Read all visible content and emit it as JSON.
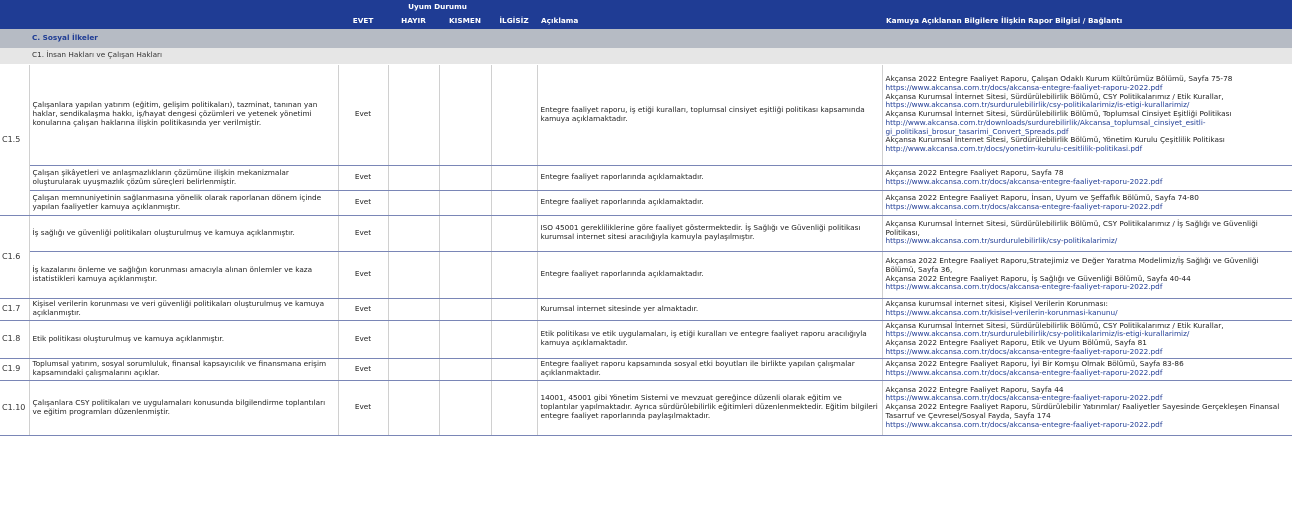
{
  "header": {
    "group_title": "Uyum Durumu",
    "col_evet": "EVET",
    "col_hayir": "HAYIR",
    "col_kismen": "KISMEN",
    "col_ilgisiz": "İLGİSİZ",
    "col_aciklama": "Açıklama",
    "col_rapor": "Kamuya Açıklanan Bilgilere İlişkin Rapor Bilgisi / Bağlantı"
  },
  "section": {
    "title": "C. Sosyal İlkeler"
  },
  "subsection": {
    "title": "C1. İnsan Hakları ve Çalışan Hakları"
  },
  "rows": [
    {
      "code": "C1.5",
      "criterion": "Çalışanlara yapılan yatırım (eğitim, gelişim politikaları), tazminat, tanınan yan haklar, sendikalaşma hakkı, iş/hayat dengesi çözümleri ve yetenek yönetimi konularına çalışan haklarına ilişkin politikasında yer verilmiştir.",
      "status": "Evet",
      "description": "Entegre faaliyet raporu, iş etiği kuralları, toplumsal cinsiyet eşitliği politikası kapsamında kamuya açıklamaktadır.",
      "report": [
        {
          "text": "Akçansa 2022 Entegre Faaliyet Raporu, Çalışan Odaklı Kurum Kültürümüz Bölümü, Sayfa 75-78",
          "link": false
        },
        {
          "text": "https://www.akcansa.com.tr/docs/akcansa-entegre-faaliyet-raporu-2022.pdf",
          "link": true
        },
        {
          "text": "Akçansa Kurumsal İnternet Sitesi, Sürdürülebilirlik Bölümü, CSY Politikalarımız / Etik Kurallar,",
          "link": false
        },
        {
          "text": "https://www.akcansa.com.tr/surdurulebilirlik/csy-politikalarimiz/is-etigi-kurallarimiz/",
          "link": true
        },
        {
          "text": "Akçansa Kurumsal İnternet Sitesi, Sürdürülebilirlik Bölümü, Toplumsal Cinsiyet Eşitliği Politikası",
          "link": false
        },
        {
          "text": "http://www.akcansa.com.tr/downloads/surdurebilirlik/Akcansa_toplumsal_cinsiyet_esitli-gi_politikasi_brosur_tasarimi_Convert_Spreads.pdf",
          "link": true
        },
        {
          "text": "Akçansa Kurumsal İnternet Sitesi, Sürdürülebilirlik Bölümü, Yönetim Kurulu Çeşitlilik Politikası",
          "link": false
        },
        {
          "text": "http://www.akcansa.com.tr/docs/yonetim-kurulu-cesitlilik-politikasi.pdf",
          "link": true
        }
      ]
    },
    {
      "code": "",
      "criterion": "Çalışan şikâyetleri ve anlaşmazlıkların çözümüne ilişkin mekanizmalar oluşturularak uyuşmazlık çözüm süreçleri belirlenmiştir.",
      "status": "Evet",
      "description": "Entegre faaliyet raporlarında açıklamaktadır.",
      "report": [
        {
          "text": "Akçansa 2022 Entegre Faaliyet Raporu, Sayfa 78",
          "link": false
        },
        {
          "text": "https://www.akcansa.com.tr/docs/akcansa-entegre-faaliyet-raporu-2022.pdf",
          "link": true
        }
      ]
    },
    {
      "code": "",
      "criterion": "Çalışan memnuniyetinin sağlanmasına yönelik olarak raporlanan dönem içinde yapılan faaliyetler kamuya açıklanmıştır.",
      "status": "Evet",
      "description": "Entegre faaliyet raporlarında açıklamaktadır.",
      "report": [
        {
          "text": "Akçansa 2022 Entegre Faaliyet Raporu, İnsan, Uyum ve Şeffaflık Bölümü, Sayfa 74-80",
          "link": false
        },
        {
          "text": "https://www.akcansa.com.tr/docs/akcansa-entegre-faaliyet-raporu-2022.pdf",
          "link": true
        }
      ]
    },
    {
      "code": "C1.6",
      "criterion": "İş sağlığı ve güvenliği politikaları oluşturulmuş ve kamuya açıklanmıştır.",
      "status": "Evet",
      "description": "ISO 45001 gerekliliklerine göre faaliyet göstermektedir. İş Sağlığı ve Güvenliği politikası kurumsal internet sitesi aracılığıyla kamuyla paylaşılmıştır.",
      "report": [
        {
          "text": "Akçansa Kurumsal İnternet Sitesi, Sürdürülebilirlik Bölümü, CSY Politikalarımız / İş Sağlığı ve Güvenliği Politikası,",
          "link": false
        },
        {
          "text": "https://www.akcansa.com.tr/surdurulebilirlik/csy-politikalarimiz/",
          "link": true
        }
      ]
    },
    {
      "code": "",
      "criterion": "İş kazalarını önleme ve sağlığın korunması amacıyla alınan önlemler ve kaza istatistikleri kamuya açıklanmıştır.",
      "status": "Evet",
      "description": "Entegre faaliyet raporlarında açıklamaktadır.",
      "report": [
        {
          "text": "Akçansa 2022 Entegre Faaliyet Raporu,Stratejimiz ve Değer Yaratma Modelimiz/İş Sağlığı ve Güvenliği Bölümü, Sayfa 36,",
          "link": false
        },
        {
          "text": "Akçansa 2022 Entegre Faaliyet Raporu, İş Sağlığı ve Güvenliği Bölümü, Sayfa 40-44",
          "link": false
        },
        {
          "text": "https://www.akcansa.com.tr/docs/akcansa-entegre-faaliyet-raporu-2022.pdf",
          "link": true
        }
      ]
    },
    {
      "code": "C1.7",
      "criterion": "Kişisel verilerin korunması ve veri güvenliği politikaları oluşturulmuş ve kamuya açıklanmıştır.",
      "status": "Evet",
      "description": "Kurumsal internet sitesinde yer almaktadır.",
      "report": [
        {
          "text": "Akçansa kurumsal internet sitesi, Kişisel Verilerin Korunması:",
          "link": false
        },
        {
          "text": "https://www.akcansa.com.tr/kisisel-verilerin-korunmasi-kanunu/",
          "link": true
        }
      ]
    },
    {
      "code": "C1.8",
      "criterion": "Etik politikası oluşturulmuş ve kamuya açıklanmıştır.",
      "status": "Evet",
      "description": "Etik politikası ve etik uygulamaları, iş etiği kuralları ve entegre faaliyet raporu aracılığıyla kamuya açıklamaktadır.",
      "report": [
        {
          "text": "Akçansa Kurumsal İnternet Sitesi, Sürdürülebilirlik Bölümü, CSY Politikalarımız / Etik Kurallar,",
          "link": false
        },
        {
          "text": "https://www.akcansa.com.tr/surdurulebilirlik/csy-politikalarimiz/is-etigi-kurallarimiz/",
          "link": true
        },
        {
          "text": "Akçansa 2022 Entegre Faaliyet Raporu, Etik ve Uyum Bölümü, Sayfa 81",
          "link": false
        },
        {
          "text": "https://www.akcansa.com.tr/docs/akcansa-entegre-faaliyet-raporu-2022.pdf",
          "link": true
        }
      ]
    },
    {
      "code": "C1.9",
      "criterion": "Toplumsal yatırım, sosyal sorumluluk, finansal kapsayıcılık ve finansmana erişim kapsamındaki çalışmalarını açıklar.",
      "status": "Evet",
      "description": "Entegre faaliyet raporu kapsamında sosyal etki boyutları ile birlikte yapılan çalışmalar açıklanmaktadır.",
      "report": [
        {
          "text": "Akçansa 2022 Entegre Faaliyet Raporu, İyi Bir Komşu Olmak Bölümü, Sayfa 83-86",
          "link": false
        },
        {
          "text": "https://www.akcansa.com.tr/docs/akcansa-entegre-faaliyet-raporu-2022.pdf",
          "link": true
        }
      ]
    },
    {
      "code": "C1.10",
      "criterion": "Çalışanlara CSY politikaları ve uygulamaları konusunda bilgilendirme toplantıları ve eğitim programları düzenlenmiştir.",
      "status": "Evet",
      "description": "14001, 45001 gibi Yönetim Sistemi ve mevzuat gereğince düzenli olarak eğitim ve toplantılar yapılmaktadır. Ayrıca sürdürülebilirlik eğitimleri düzenlenmektedir. Eğitim bilgileri entegre faaliyet raporlarında paylaşılmaktadır.",
      "report": [
        {
          "text": "Akçansa 2022 Entegre Faaliyet Raporu, Sayfa 44",
          "link": false
        },
        {
          "text": "https://www.akcansa.com.tr/docs/akcansa-entegre-faaliyet-raporu-2022.pdf",
          "link": true
        },
        {
          "text": "Akçansa 2022 Entegre Faaliyet Raporu, Sürdürülebilir Yatırımlar/ Faaliyetler Sayesinde Gerçekleşen Finansal Tasarruf ve Çevresel/Sosyal Fayda, Sayfa 174",
          "link": false
        },
        {
          "text": "https://www.akcansa.com.tr/docs/akcansa-entegre-faaliyet-raporu-2022.pdf",
          "link": true
        }
      ]
    }
  ]
}
